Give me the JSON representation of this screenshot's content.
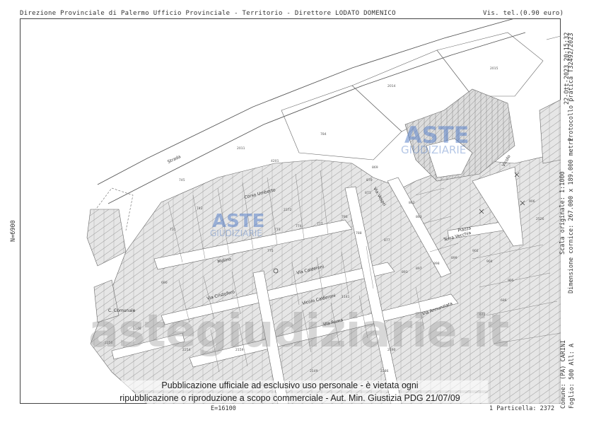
{
  "header": {
    "office": "Direzione Provinciale di Palermo  Ufficio Provinciale - Territorio - Direttore LODATO DOMENICO",
    "fee": "Vis. tel.(0.90 euro)"
  },
  "right_margin": {
    "timestamp": "22-Ott-2023 20:15:32",
    "scale": "Scala originale: 1:1000",
    "dimensions": "Dimensione cornice: 267.000 x 189.000 metri",
    "protocol": "Protocollo pratica T32492/2023"
  },
  "footer_right": {
    "comune": "Comune: (PA) CARINI",
    "foglio": "Foglio: 500 All: A",
    "particella": "1 Particella: 2372"
  },
  "coordinates": {
    "north": "N=6900",
    "east": "E=16100"
  },
  "watermark": {
    "aste": "ASTE",
    "giudiziarie": "GIUDIZIARIE",
    "site": "astegiudiziarie.it"
  },
  "notice": {
    "line1": "Pubblicazione ufficiale ad esclusivo uso personale - è vietata ogni",
    "line2": "ripubblicazione o riproduzione a scopo commerciale - Aut. Min. Giustizia PDG 21/07/09"
  },
  "streets": [
    "Strada",
    "Via",
    "Molino",
    "Corso Umberto",
    "Via Calderoni",
    "Vicolo Calderoni",
    "Via Cristoforo",
    "Via Roma",
    "Via Vespri",
    "Via Annunziata",
    "C. Comunale",
    "Piazza",
    "Vicolo",
    "Terra Vecchia"
  ],
  "parcel_numbers": [
    "2372",
    "784",
    "2014",
    "2015",
    "2011",
    "4201",
    "745",
    "742",
    "731",
    "773",
    "774",
    "775",
    "777",
    "786",
    "788",
    "862",
    "863",
    "869",
    "870",
    "871",
    "877",
    "893",
    "897",
    "898",
    "899",
    "902",
    "904",
    "905",
    "906",
    "2526",
    "672",
    "686",
    "690",
    "2159",
    "2156",
    "2149",
    "1141",
    "1146",
    "2250",
    "2254",
    "2286",
    "2190",
    "2186",
    "2191"
  ],
  "colors": {
    "parcel_fill": "#e6e6e6",
    "line": "#555555",
    "watermark_blue": "#5a82c8"
  }
}
